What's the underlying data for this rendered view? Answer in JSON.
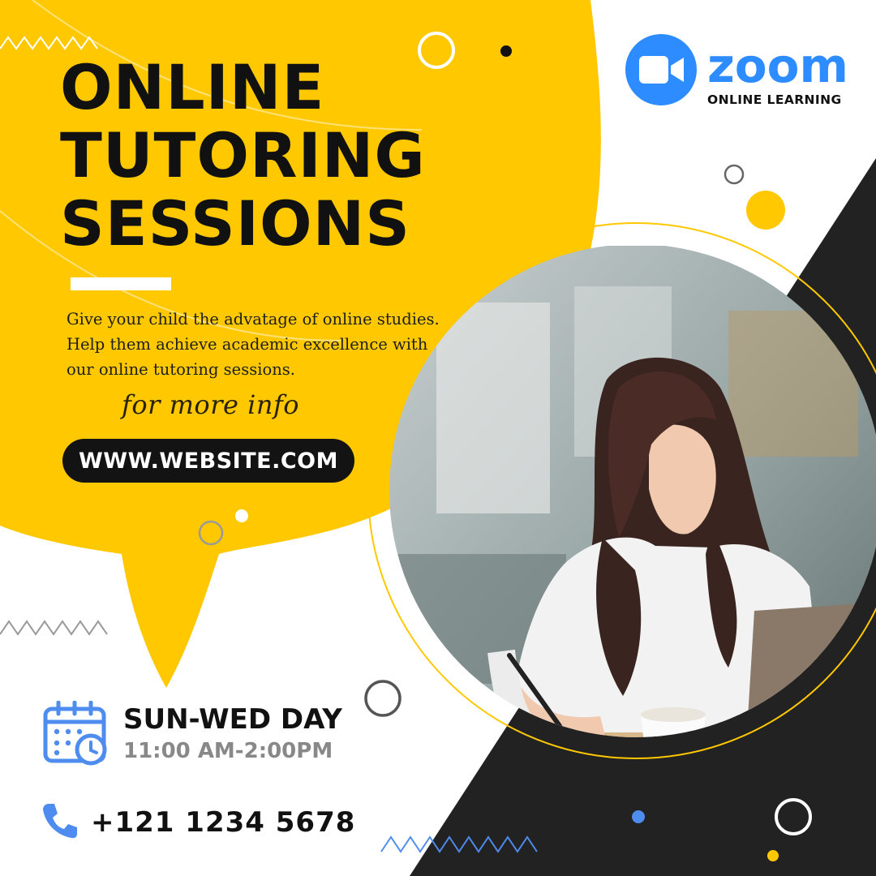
{
  "headline": {
    "line1": "ONLINE",
    "line2": "TUTORING",
    "line3": "SESSIONS"
  },
  "description": {
    "line1": "Give your child the advatage of online studies.",
    "line2": "Help them achieve academic excellence with",
    "line3": "our online tutoring sessions."
  },
  "cta": {
    "note": "for more info",
    "website": "WWW.WEBSITE.COM"
  },
  "brand": {
    "name": "zoom",
    "tagline": "ONLINE LEARNING",
    "color": "#2d8cff"
  },
  "schedule": {
    "days": "SUN-WED DAY",
    "time": "11:00 AM-2:00PM",
    "icon": "calendar-clock-icon"
  },
  "contact": {
    "phone": "+121 1234 5678",
    "icon": "phone-icon"
  },
  "colors": {
    "accent_yellow": "#ffc800",
    "dark": "#222222",
    "brand_blue": "#2d8cff",
    "icon_blue": "#4f8cf0"
  }
}
